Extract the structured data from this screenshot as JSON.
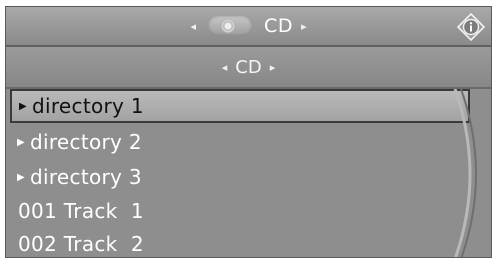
{
  "header": {
    "source_label": "CD",
    "left_arrow": "◂",
    "right_arrow": "▸",
    "info_icon": "i-diamond-icon"
  },
  "subheader": {
    "source_label": "CD",
    "left_arrow": "◂",
    "right_arrow": "▸"
  },
  "list": {
    "items": [
      {
        "label": "directory 1",
        "type": "directory",
        "selected": true
      },
      {
        "label": "directory 2",
        "type": "directory",
        "selected": false
      },
      {
        "label": "directory 3",
        "type": "directory",
        "selected": false
      },
      {
        "label": "001 Track  1",
        "type": "track",
        "selected": false
      },
      {
        "label": "002 Track  2",
        "type": "track",
        "selected": false
      }
    ]
  },
  "colors": {
    "background": "#8e8e8e",
    "selected_bg": "#b3b3b3",
    "text": "#ffffff"
  }
}
